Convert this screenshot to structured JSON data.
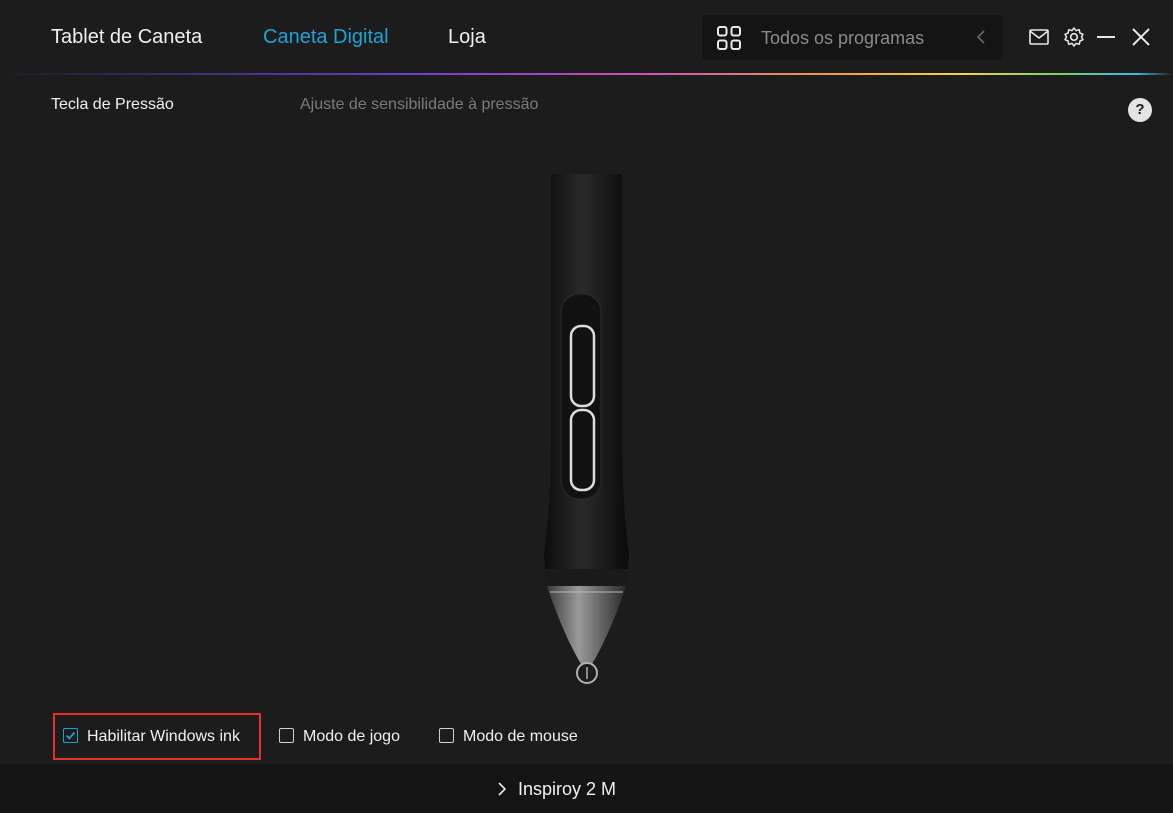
{
  "header": {
    "tabs": [
      {
        "label": "Tablet de Caneta"
      },
      {
        "label": "Caneta Digital"
      },
      {
        "label": "Loja"
      }
    ],
    "active_tab": "Caneta Digital",
    "programs_label": "Todos os programas"
  },
  "subheader": {
    "left": "Tecla de Pressão",
    "middle": "Ajuste de sensibilidade à pressão",
    "help": "?"
  },
  "options": [
    {
      "label": "Habilitar Windows ink",
      "checked": true
    },
    {
      "label": "Modo de jogo",
      "checked": false
    },
    {
      "label": "Modo de mouse",
      "checked": false
    }
  ],
  "footer": {
    "device_name": "Inspiroy 2 M"
  },
  "colors": {
    "accent": "#1fa3d6",
    "highlight": "#e0312c",
    "background": "#1c1c1c"
  }
}
